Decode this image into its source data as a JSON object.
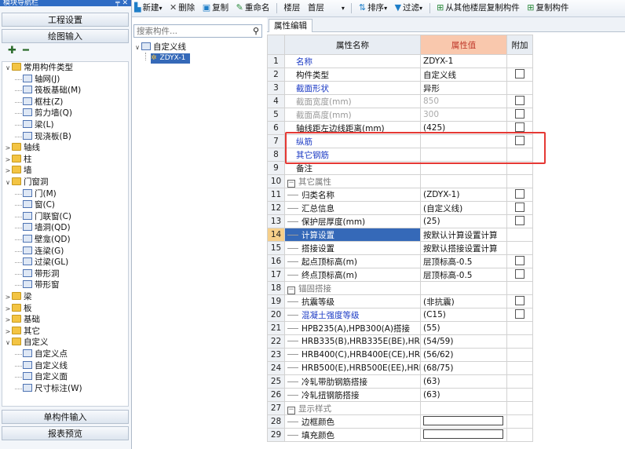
{
  "nav": {
    "title": "模块导航栏",
    "title_controls": "╤ ✕",
    "engineering_btn": "工程设置",
    "drawing_btn": "绘图输入",
    "tool_add": "✚",
    "tool_remove": "━",
    "single_btn": "单构件输入",
    "report_btn": "报表预览",
    "tree": [
      {
        "label": "常用构件类型",
        "level": 0,
        "toggle": "∨",
        "icon": "folder"
      },
      {
        "label": "轴网(J)",
        "level": 1,
        "icon": "comp"
      },
      {
        "label": "筏板基础(M)",
        "level": 1,
        "icon": "comp"
      },
      {
        "label": "框柱(Z)",
        "level": 1,
        "icon": "comp"
      },
      {
        "label": "剪力墙(Q)",
        "level": 1,
        "icon": "comp"
      },
      {
        "label": "梁(L)",
        "level": 1,
        "icon": "comp"
      },
      {
        "label": "现浇板(B)",
        "level": 1,
        "icon": "comp"
      },
      {
        "label": "轴线",
        "level": 0,
        "toggle": ">",
        "icon": "folder"
      },
      {
        "label": "柱",
        "level": 0,
        "toggle": ">",
        "icon": "folder"
      },
      {
        "label": "墙",
        "level": 0,
        "toggle": ">",
        "icon": "folder"
      },
      {
        "label": "门窗洞",
        "level": 0,
        "toggle": "∨",
        "icon": "folder"
      },
      {
        "label": "门(M)",
        "level": 1,
        "icon": "comp"
      },
      {
        "label": "窗(C)",
        "level": 1,
        "icon": "comp"
      },
      {
        "label": "门联窗(C)",
        "level": 1,
        "icon": "comp"
      },
      {
        "label": "墙洞(QD)",
        "level": 1,
        "icon": "comp"
      },
      {
        "label": "壁龛(QD)",
        "level": 1,
        "icon": "comp"
      },
      {
        "label": "连梁(G)",
        "level": 1,
        "icon": "comp"
      },
      {
        "label": "过梁(GL)",
        "level": 1,
        "icon": "comp"
      },
      {
        "label": "带形洞",
        "level": 1,
        "icon": "comp"
      },
      {
        "label": "带形窗",
        "level": 1,
        "icon": "comp"
      },
      {
        "label": "梁",
        "level": 0,
        "toggle": ">",
        "icon": "folder"
      },
      {
        "label": "板",
        "level": 0,
        "toggle": ">",
        "icon": "folder"
      },
      {
        "label": "基础",
        "level": 0,
        "toggle": ">",
        "icon": "folder"
      },
      {
        "label": "其它",
        "level": 0,
        "toggle": ">",
        "icon": "folder"
      },
      {
        "label": "自定义",
        "level": 0,
        "toggle": "∨",
        "icon": "folder"
      },
      {
        "label": "自定义点",
        "level": 1,
        "icon": "comp"
      },
      {
        "label": "自定义线",
        "level": 1,
        "icon": "comp"
      },
      {
        "label": "自定义面",
        "level": 1,
        "icon": "comp"
      },
      {
        "label": "尺寸标注(W)",
        "level": 1,
        "icon": "comp"
      }
    ]
  },
  "toolbar": {
    "new": "新建",
    "delete": "删除",
    "copy": "复制",
    "rename": "重命名",
    "floor_label": "楼层",
    "floor_value": "首层",
    "sort": "排序",
    "filter": "过滤",
    "copy_from_floor": "从其他楼层复制构件",
    "copy_component": "复制构件"
  },
  "search": {
    "placeholder": "搜索构件..."
  },
  "mid_tree": {
    "root": "自定义线",
    "child": "ZDYX-1"
  },
  "props": {
    "tab": "属性编辑",
    "headers": {
      "name": "属性名称",
      "value": "属性值",
      "extra": "附加"
    },
    "rows": [
      {
        "num": "1",
        "name": "名称",
        "value": "ZDYX-1",
        "style": "blue",
        "cb": false
      },
      {
        "num": "2",
        "name": "构件类型",
        "value": "自定义线",
        "cb": true
      },
      {
        "num": "3",
        "name": "截面形状",
        "value": "异形",
        "style": "blue",
        "cb": false
      },
      {
        "num": "4",
        "name": "截面宽度(mm)",
        "value": "850",
        "style": "gray",
        "cb": true
      },
      {
        "num": "5",
        "name": "截面高度(mm)",
        "value": "300",
        "style": "gray",
        "cb": true
      },
      {
        "num": "6",
        "name": "轴线距左边线距离(mm)",
        "value": "(425)",
        "cb": true
      },
      {
        "num": "7",
        "name": "纵筋",
        "value": "",
        "style": "blue",
        "cb": true
      },
      {
        "num": "8",
        "name": "其它钢筋",
        "value": "",
        "style": "blue",
        "cb": false
      },
      {
        "num": "9",
        "name": "备注",
        "value": "",
        "cb": false
      },
      {
        "num": "10",
        "name": "其它属性",
        "value": "",
        "group": true
      },
      {
        "num": "11",
        "name": "归类名称",
        "value": "(ZDYX-1)",
        "indent": true,
        "cb": true
      },
      {
        "num": "12",
        "name": "汇总信息",
        "value": "(自定义线)",
        "indent": true,
        "cb": true
      },
      {
        "num": "13",
        "name": "保护层厚度(mm)",
        "value": "(25)",
        "indent": true,
        "cb": true
      },
      {
        "num": "14",
        "name": "计算设置",
        "value": "按默认计算设置计算",
        "indent": true,
        "selected": true,
        "cb": false
      },
      {
        "num": "15",
        "name": "搭接设置",
        "value": "按默认搭接设置计算",
        "indent": true,
        "cb": false
      },
      {
        "num": "16",
        "name": "起点顶标高(m)",
        "value": "层顶标高-0.5",
        "indent": true,
        "cb": true
      },
      {
        "num": "17",
        "name": "终点顶标高(m)",
        "value": "层顶标高-0.5",
        "indent": true,
        "cb": true
      },
      {
        "num": "18",
        "name": "锚固搭接",
        "value": "",
        "group": true
      },
      {
        "num": "19",
        "name": "抗震等级",
        "value": "(非抗震)",
        "indent": true,
        "cb": true
      },
      {
        "num": "20",
        "name": "混凝土强度等级",
        "value": "(C15)",
        "indent": true,
        "style": "blue",
        "cb": true
      },
      {
        "num": "21",
        "name": "HPB235(A),HPB300(A)搭接",
        "value": "(55)",
        "indent": true,
        "cb": false
      },
      {
        "num": "22",
        "name": "HRB335(B),HRB335E(BE),HRBF",
        "value": "(54/59)",
        "indent": true,
        "cb": false
      },
      {
        "num": "23",
        "name": "HRB400(C),HRB400E(CE),HRBF",
        "value": "(56/62)",
        "indent": true,
        "cb": false
      },
      {
        "num": "24",
        "name": "HRB500(E),HRB500E(EE),HRBF",
        "value": "(68/75)",
        "indent": true,
        "cb": false
      },
      {
        "num": "25",
        "name": "冷轧带肋钢筋搭接",
        "value": "(63)",
        "indent": true,
        "cb": false
      },
      {
        "num": "26",
        "name": "冷轧扭钢筋搭接",
        "value": "(63)",
        "indent": true,
        "cb": false
      },
      {
        "num": "27",
        "name": "显示样式",
        "value": "",
        "group": true
      },
      {
        "num": "28",
        "name": "边框颜色",
        "value": "",
        "indent": true,
        "color": true,
        "cb": false
      },
      {
        "num": "29",
        "name": "填充颜色",
        "value": "",
        "indent": true,
        "color": true,
        "cb": false
      }
    ]
  }
}
